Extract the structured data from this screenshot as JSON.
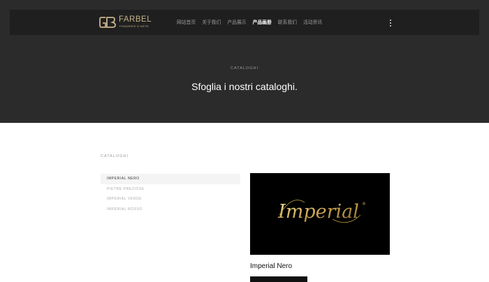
{
  "brand": {
    "name": "FARBEL",
    "tagline": "FONDERIE D'ARTE",
    "color": "#c7b48a"
  },
  "nav": {
    "items": [
      "网站首页",
      "关于我们",
      "产品展示",
      "产品画册",
      "联系我们",
      "活动资讯"
    ],
    "active_index": 3,
    "menu_icon": "kebab-menu-icon"
  },
  "hero": {
    "eyebrow": "CATALOGHI",
    "title": "Sfoglia i nostri cataloghi.",
    "background": "#2b2b2b"
  },
  "catalogs": {
    "section_label": "CATALOGHI",
    "items": [
      "IMPERIAL NERO",
      "PIETRE PREZIOSE",
      "IMPERIAL VERDE",
      "IMPERIAL ROSSO"
    ],
    "active_index": 0,
    "selected": {
      "title": "Imperial Nero",
      "image_wordmark": "Imperial",
      "image_wordmark_mark": "®"
    }
  }
}
